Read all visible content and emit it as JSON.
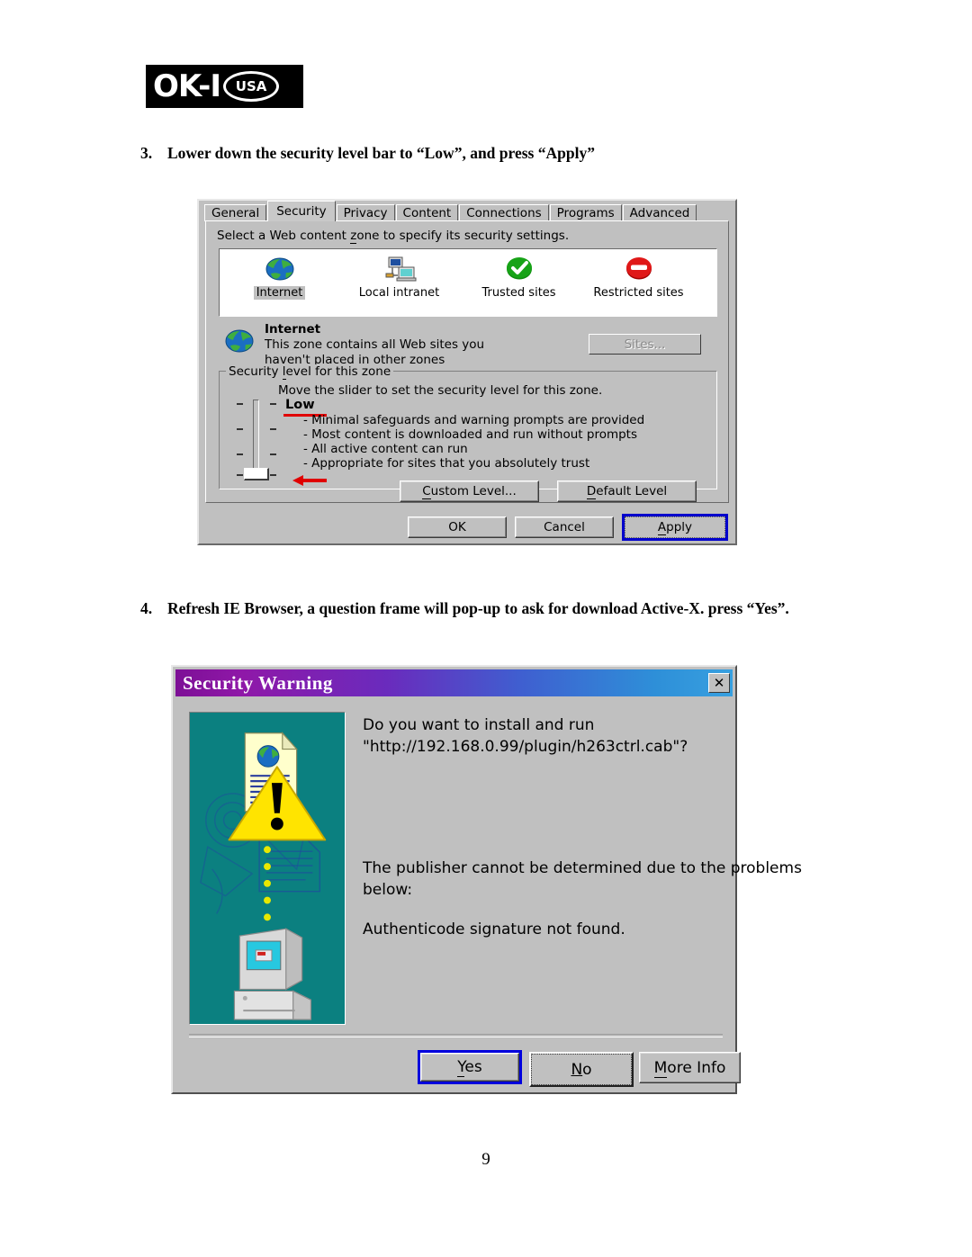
{
  "document": {
    "logo": {
      "brand": "OK-I",
      "badge": "USA"
    },
    "page_number": "9",
    "steps": [
      {
        "number": "3.",
        "text": "Lower down the security level bar to “Low”, and press “Apply”"
      },
      {
        "number": "4.",
        "text": "Refresh IE Browser, a question frame will pop-up to ask for download Active-X. press “Yes”."
      }
    ]
  },
  "internet_options": {
    "tabs": [
      {
        "label": "General",
        "selected": false
      },
      {
        "label": "Security",
        "selected": true
      },
      {
        "label": "Privacy",
        "selected": false
      },
      {
        "label": "Content",
        "selected": false
      },
      {
        "label": "Connections",
        "selected": false
      },
      {
        "label": "Programs",
        "selected": false
      },
      {
        "label": "Advanced",
        "selected": false
      }
    ],
    "zone_instruction_pre": "Select a Web content ",
    "zone_instruction_accel": "z",
    "zone_instruction_post": "one to specify its security settings.",
    "zones": [
      {
        "label": "Internet",
        "icon": "globe-icon",
        "selected": true
      },
      {
        "label": "Local intranet",
        "icon": "network-computers-icon",
        "selected": false
      },
      {
        "label": "Trusted sites",
        "icon": "green-check-icon",
        "selected": false
      },
      {
        "label": "Restricted sites",
        "icon": "red-minus-icon",
        "selected": false
      }
    ],
    "current_zone": {
      "title": "Internet",
      "description_line1": "This zone contains all Web sites you",
      "description_line2": "haven't placed in other zones",
      "sites_button": "Sites...",
      "sites_button_enabled": false
    },
    "security_level": {
      "group_legend_pre": "Security ",
      "group_legend_accel": "l",
      "group_legend_post": "evel for this zone",
      "hint": "Move the slider to set the security level for this zone.",
      "level_name": "Low",
      "bullets": [
        "- Minimal safeguards and warning prompts are provided",
        "- Most content is downloaded and run without prompts",
        "- All active content can run",
        "- Appropriate for sites that you absolutely trust"
      ],
      "slider_position": "bottom",
      "annotation_color": "#e00000"
    },
    "level_buttons": [
      {
        "label_accel": "C",
        "label_rest": "ustom Level..."
      },
      {
        "label_accel": "D",
        "label_rest": "efault Level"
      }
    ],
    "action_buttons": {
      "ok": "OK",
      "cancel": "Cancel",
      "apply_accel": "A",
      "apply_rest": "pply",
      "apply_focused": true
    }
  },
  "security_warning": {
    "title": "Security Warning",
    "close_icon": "✕",
    "question_line1": "Do you want to install and run",
    "question_line2": "\"http://192.168.0.99/plugin/h263ctrl.cab\"?",
    "problem_line1": "The publisher cannot be determined due to the problems",
    "problem_line2": "below:",
    "problem_detail": "Authenticode signature not found.",
    "buttons": {
      "yes_accel": "Y",
      "yes_rest": "es",
      "yes_default": true,
      "no_accel": "N",
      "no_rest": "o",
      "more_info_accel": "M",
      "more_info_rest": "ore Info"
    },
    "illustration": {
      "background_color": "#0b8080",
      "warning_triangle_color": "#ffe400",
      "document_color": "#ffffcc",
      "elements": [
        "document-with-globe-icon",
        "warning-triangle-icon",
        "download-dots",
        "computer-icon"
      ]
    },
    "titlebar_gradient_from": "#7d0f96",
    "titlebar_gradient_to": "#37a0e0"
  }
}
